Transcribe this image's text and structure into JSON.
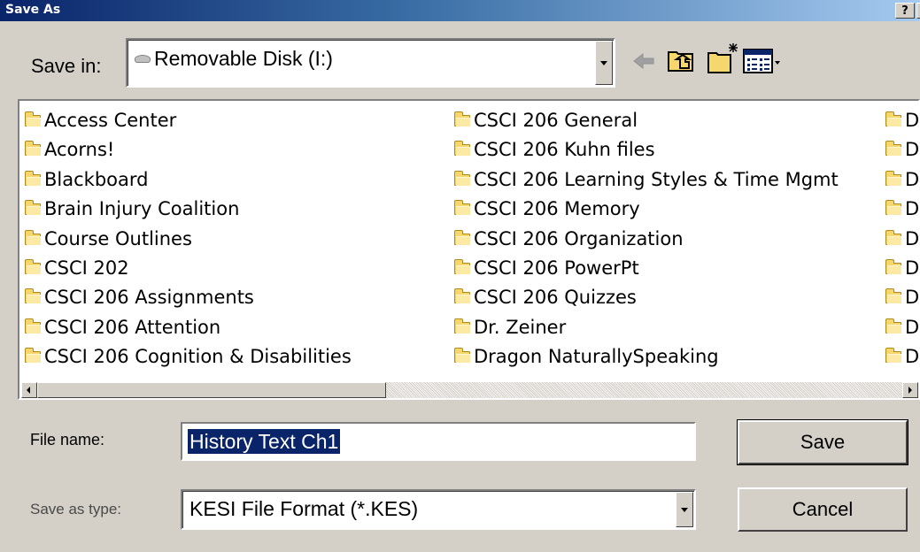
{
  "window": {
    "title": "Save As",
    "help_button": "?",
    "close_button": "✕"
  },
  "save_in": {
    "label": "Save in:",
    "value": "Removable Disk (I:)"
  },
  "toolbar": {
    "icons": [
      "back-arrow-icon",
      "up-one-level-icon",
      "create-new-folder-icon",
      "view-menu-icon"
    ]
  },
  "files": {
    "column1": [
      "Access Center",
      "Acorns!",
      "Blackboard",
      "Brain Injury Coalition",
      "Course Outlines",
      "CSCI 202",
      "CSCI 206 Assignments",
      "CSCI 206 Attention",
      "CSCI 206 Cognition & Disabilities"
    ],
    "column2": [
      "CSCI 206 General",
      "CSCI 206 Kuhn files",
      "CSCI 206 Learning Styles & Time Mgmt",
      "CSCI 206 Memory",
      "CSCI 206 Organization",
      "CSCI 206 PowerPt",
      "CSCI 206 Quizzes",
      "Dr. Zeiner",
      "Dragon NaturallySpeaking"
    ],
    "column3": [
      "D",
      "D",
      "D",
      "D",
      "D",
      "D",
      "D",
      "D",
      "D"
    ]
  },
  "file_name": {
    "label": "File name:",
    "value": "History Text Ch1"
  },
  "save_as_type": {
    "label": "Save as type:",
    "value": "KESI File Format (*.KES)"
  },
  "buttons": {
    "save": "Save",
    "cancel": "Cancel"
  },
  "colors": {
    "dialog_bg": "#d4d0c8",
    "title_bar": "#0a246a",
    "selection": "#0a246a",
    "folder": "#f5d76e"
  }
}
